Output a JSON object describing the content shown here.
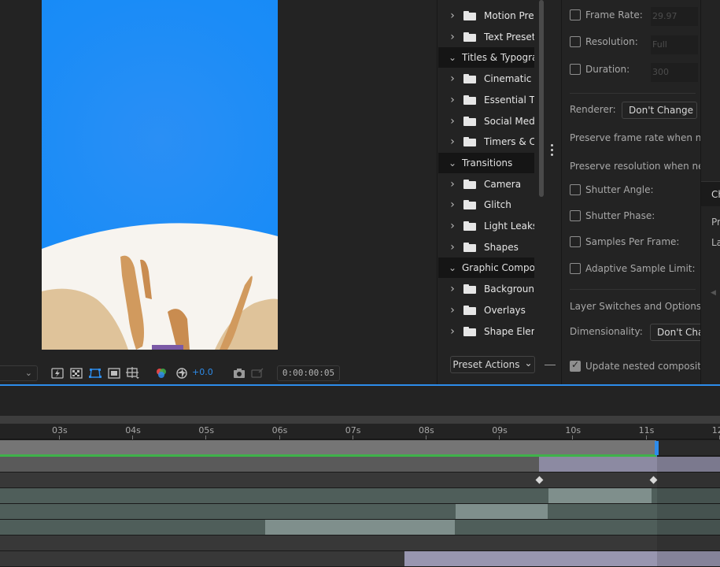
{
  "viewer": {
    "zoom_chevron": "⌄",
    "exposure": "+0.0",
    "timecode": "0:00:00:05"
  },
  "presets": {
    "items": [
      {
        "type": "item",
        "label": "Motion Presets"
      },
      {
        "type": "item",
        "label": "Text Presets"
      },
      {
        "type": "cat",
        "label": "Titles & Typography"
      },
      {
        "type": "item",
        "label": "Cinematic Titles"
      },
      {
        "type": "item",
        "label": "Essential Titles"
      },
      {
        "type": "item",
        "label": "Social Media"
      },
      {
        "type": "item",
        "label": "Timers & Counters"
      },
      {
        "type": "cat",
        "label": "Transitions"
      },
      {
        "type": "item",
        "label": "Camera"
      },
      {
        "type": "item",
        "label": "Glitch"
      },
      {
        "type": "item",
        "label": "Light Leaks"
      },
      {
        "type": "item",
        "label": "Shapes"
      },
      {
        "type": "cat",
        "label": "Graphic Components"
      },
      {
        "type": "item",
        "label": "Backgrounds"
      },
      {
        "type": "item",
        "label": "Overlays"
      },
      {
        "type": "item",
        "label": "Shape Elements"
      }
    ],
    "actions_label": "Preset Actions",
    "actions_chevron": "⌄"
  },
  "settings": {
    "frame_rate_label": "Frame Rate:",
    "frame_rate_value": "29.97",
    "resolution_label": "Resolution:",
    "resolution_value": "Full",
    "duration_label": "Duration:",
    "duration_value": "300",
    "renderer_label": "Renderer:",
    "renderer_value": "Don't Change",
    "preserve_frame_rate": "Preserve frame rate when nested",
    "preserve_resolution": "Preserve resolution when nested",
    "shutter_angle": "Shutter Angle:",
    "shutter_phase": "Shutter Phase:",
    "samples_per_frame": "Samples Per Frame:",
    "adaptive_sample_limit": "Adaptive Sample Limit:",
    "layer_switches": "Layer Switches and Options",
    "dimensionality_label": "Dimensionality:",
    "dimensionality_value": "Don't Change",
    "update_nested": "Update nested compositions",
    "update_nested_checked": true
  },
  "right_edge": {
    "tab_label": "Ch",
    "line1": "Pr",
    "line2": "La",
    "arrow": "◀"
  },
  "timeline": {
    "ruler_labels": [
      "03s",
      "04s",
      "05s",
      "06s",
      "07s",
      "08s",
      "09s",
      "10s",
      "11s",
      "12"
    ],
    "playhead_time": "11s"
  },
  "colors": {
    "accent": "#2d8ceb",
    "work_area": "#757575",
    "work_area_green": "#3fb24a",
    "comp_blue": "#1a8cf7"
  }
}
